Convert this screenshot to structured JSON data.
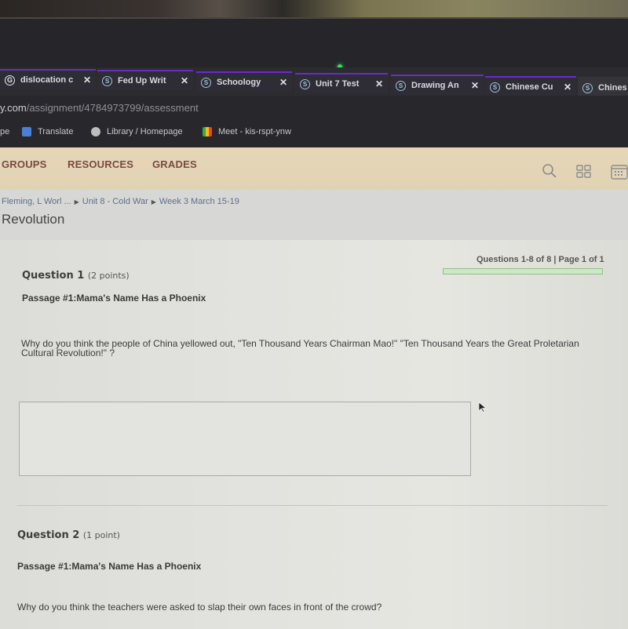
{
  "browser": {
    "tabs": [
      {
        "icon": "google-icon",
        "label": "dislocation c",
        "active": false
      },
      {
        "icon": "schoology-icon",
        "label": "Fed Up Writ",
        "active": false
      },
      {
        "icon": "schoology-icon",
        "label": "Schoology",
        "active": false
      },
      {
        "icon": "schoology-icon",
        "label": "Unit 7 Test",
        "active": false
      },
      {
        "icon": "schoology-icon",
        "label": "Drawing An",
        "active": false
      },
      {
        "icon": "schoology-icon",
        "label": "Chinese Cu",
        "active": false
      },
      {
        "icon": "schoology-icon",
        "label": "Chines",
        "active": true
      }
    ],
    "close_glyph": "✕",
    "url_host": "y.com",
    "url_path": "/assignment/4784973799/assessment",
    "bookmarks": [
      {
        "label": "pe"
      },
      {
        "label": "Translate",
        "icon": "google-translate-icon"
      },
      {
        "label": "Library / Homepage",
        "icon": "globe-icon"
      },
      {
        "label": "Meet - kis-rspt-ynw",
        "icon": "google-meet-icon"
      }
    ]
  },
  "nav": {
    "items": [
      "GROUPS",
      "RESOURCES",
      "GRADES"
    ],
    "icons": [
      "search-icon",
      "apps-grid-icon",
      "calendar-icon"
    ]
  },
  "breadcrumb": [
    "Fleming, L Worl ...",
    "Unit 8 - Cold War",
    "Week 3 March 15-19"
  ],
  "page_title": "Revolution",
  "pager": "Questions 1-8 of 8 | Page 1 of 1",
  "progress_fraction": 1.0,
  "questions": [
    {
      "title": "Question 1",
      "points": "(2 points)",
      "passage": "Passage #1:Mama's Name Has a Phoenix",
      "text": "Why do you think the people of China yellowed out, \"Ten Thousand Years Chairman Mao!\" \"Ten Thousand Years the Great Proletarian Cultural Revolution!\" ?",
      "answer": ""
    },
    {
      "title": "Question 2",
      "points": "(1 point)",
      "passage": "Passage #1:Mama's Name Has a Phoenix",
      "text": "Why do you think the teachers were asked to slap their own faces in front of the crowd?"
    }
  ]
}
